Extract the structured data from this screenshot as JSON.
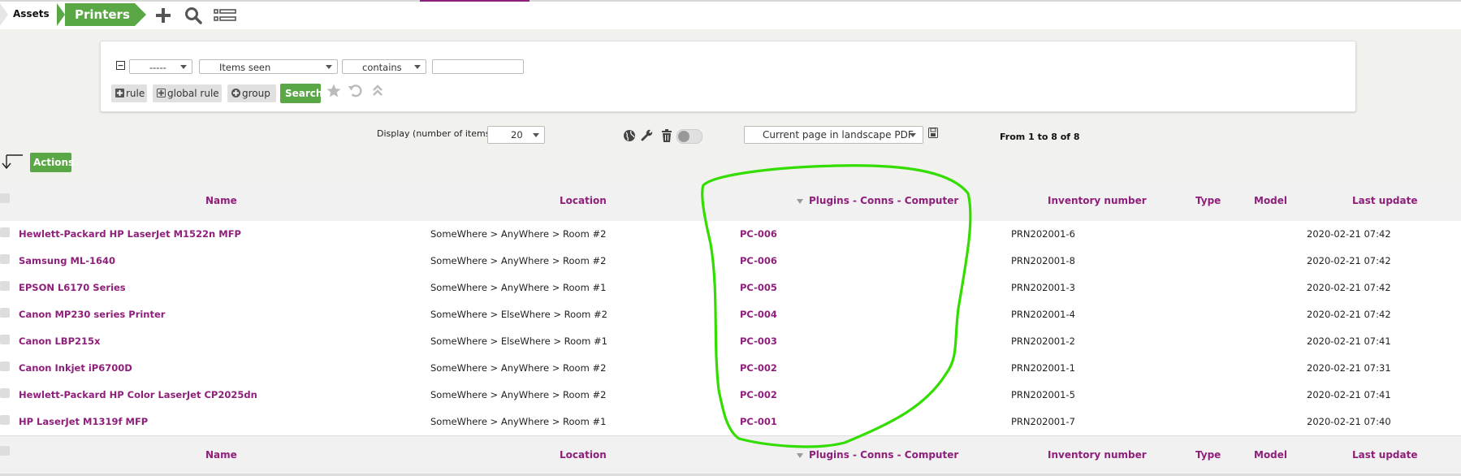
{
  "breadcrumb": {
    "assets": "Assets",
    "printers": "Printers"
  },
  "header_icons": {
    "add": "plus-icon",
    "search": "search-icon",
    "list": "list-icon"
  },
  "search": {
    "field_select": "-----",
    "criteria_select": "Items seen",
    "operator_select": "contains",
    "value": "",
    "rule_label": "rule",
    "global_rule_label": "global rule",
    "group_label": "group",
    "search_label": "Search"
  },
  "display": {
    "label": "Display (number of items)",
    "count": "20",
    "export_select": "Current page in landscape PDF",
    "pager": "From 1 to 8 of 8"
  },
  "actions_label": "Actions",
  "columns": {
    "name": "Name",
    "location": "Location",
    "plugin": "Plugins - Conns - Computer",
    "inventory": "Inventory number",
    "type": "Type",
    "model": "Model",
    "last_update": "Last update"
  },
  "rows": [
    {
      "name": "Hewlett-Packard HP LaserJet M1522n MFP",
      "location": "SomeWhere > AnyWhere > Room #2",
      "computer": "PC-006",
      "inventory": "PRN202001-6",
      "last_update": "2020-02-21 07:42"
    },
    {
      "name": "Samsung ML-1640",
      "location": "SomeWhere > AnyWhere > Room #2",
      "computer": "PC-006",
      "inventory": "PRN202001-8",
      "last_update": "2020-02-21 07:42"
    },
    {
      "name": "EPSON L6170 Series",
      "location": "SomeWhere > AnyWhere > Room #1",
      "computer": "PC-005",
      "inventory": "PRN202001-3",
      "last_update": "2020-02-21 07:42"
    },
    {
      "name": "Canon MP230 series Printer",
      "location": "SomeWhere > ElseWhere > Room #2",
      "computer": "PC-004",
      "inventory": "PRN202001-4",
      "last_update": "2020-02-21 07:42"
    },
    {
      "name": "Canon LBP215x",
      "location": "SomeWhere > ElseWhere > Room #1",
      "computer": "PC-003",
      "inventory": "PRN202001-2",
      "last_update": "2020-02-21 07:41"
    },
    {
      "name": "Canon Inkjet iP6700D",
      "location": "SomeWhere > AnyWhere > Room #2",
      "computer": "PC-002",
      "inventory": "PRN202001-1",
      "last_update": "2020-02-21 07:31"
    },
    {
      "name": "Hewlett-Packard HP Color LaserJet CP2025dn",
      "location": "SomeWhere > AnyWhere > Room #2",
      "computer": "PC-002",
      "inventory": "PRN202001-5",
      "last_update": "2020-02-21 07:41"
    },
    {
      "name": "HP LaserJet M1319f MFP",
      "location": "SomeWhere > AnyWhere > Room #1",
      "computer": "PC-001",
      "inventory": "PRN202001-7",
      "last_update": "2020-02-21 07:40"
    }
  ],
  "colors": {
    "brand_green": "#5aa745",
    "link_purple": "#8e1f7a",
    "annotation_green": "#33dd00"
  }
}
